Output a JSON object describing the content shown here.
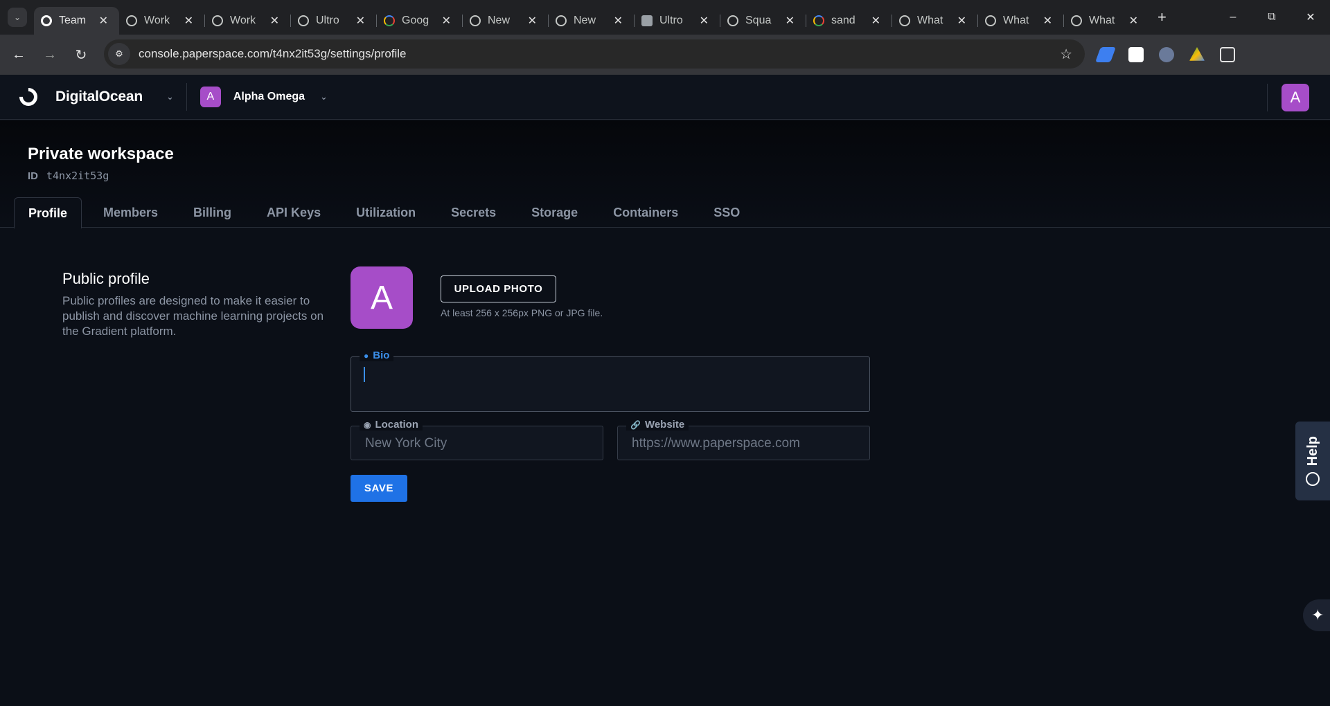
{
  "browser": {
    "tabs": [
      {
        "title": "Team",
        "icon": "digitalocean-favicon",
        "active": true
      },
      {
        "title": "Work",
        "icon": "openai-favicon"
      },
      {
        "title": "Work",
        "icon": "openai-favicon"
      },
      {
        "title": "Ultro",
        "icon": "ultro-favicon"
      },
      {
        "title": "Goog",
        "icon": "google-ads-favicon"
      },
      {
        "title": "New",
        "icon": "chrome-favicon"
      },
      {
        "title": "New",
        "icon": "chrome-favicon"
      },
      {
        "title": "Ultro",
        "icon": "box-favicon"
      },
      {
        "title": "Squa",
        "icon": "squarespace-favicon"
      },
      {
        "title": "sand",
        "icon": "google-favicon"
      },
      {
        "title": "What",
        "icon": "openai-favicon"
      },
      {
        "title": "What",
        "icon": "openai-favicon"
      },
      {
        "title": "What",
        "icon": "openai-favicon"
      }
    ],
    "url": "console.paperspace.com/t4nx2it53g/settings/profile",
    "profile_initial": "A"
  },
  "app": {
    "brand": "DigitalOcean",
    "team_initial": "A",
    "team_name": "Alpha Omega",
    "user_initial": "A"
  },
  "workspace": {
    "title": "Private workspace",
    "id_label": "ID",
    "id_value": "t4nx2it53g"
  },
  "tabs": [
    "Profile",
    "Members",
    "Billing",
    "API Keys",
    "Utilization",
    "Secrets",
    "Storage",
    "Containers",
    "SSO"
  ],
  "profile": {
    "heading": "Public profile",
    "description": "Public profiles are designed to make it easier to publish and discover machine learning projects on the Gradient platform.",
    "avatar_initial": "A",
    "upload_label": "UPLOAD PHOTO",
    "upload_hint": "At least 256 x 256px PNG or JPG file.",
    "bio_label": "Bio",
    "bio_value": "",
    "location_label": "Location",
    "location_placeholder": "New York City",
    "website_label": "Website",
    "website_placeholder": "https://www.paperspace.com",
    "save_label": "SAVE"
  },
  "help": {
    "label": "Help"
  },
  "colors": {
    "accent": "#1f72e6",
    "avatar": "#a64dc8",
    "focus": "#3b8fea"
  }
}
